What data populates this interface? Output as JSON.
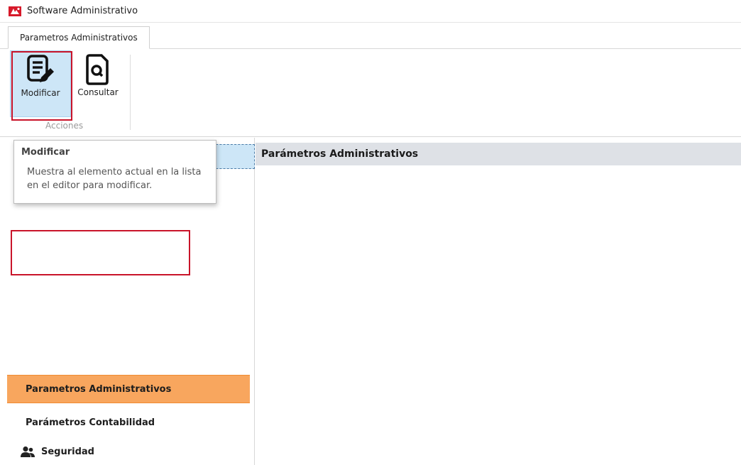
{
  "window": {
    "title": "Software Administrativo",
    "icon": "app-logo-icon"
  },
  "ribbon": {
    "tab_label": "Parametros Administrativos",
    "group_label": "Acciones",
    "buttons": [
      {
        "label": "Modificar",
        "icon": "edit-document-icon",
        "state": "highlighted"
      },
      {
        "label": "Consultar",
        "icon": "search-document-icon"
      }
    ]
  },
  "tooltip": {
    "title": "Modificar",
    "body": "Muestra al elemento actual en la lista en el editor para modificar."
  },
  "nav": {
    "items": [
      {
        "label": "Parametros Administrativos",
        "state": "active"
      },
      {
        "label": "Parámetros Contabilidad"
      },
      {
        "label": "Seguridad",
        "icon": "users-icon"
      }
    ]
  },
  "main": {
    "header": "Parámetros Administrativos"
  },
  "colors": {
    "accent": "#f8a65e",
    "selection": "#cde6f7",
    "highlight_border": "#c9142a",
    "header_bg": "#dee1e6"
  }
}
